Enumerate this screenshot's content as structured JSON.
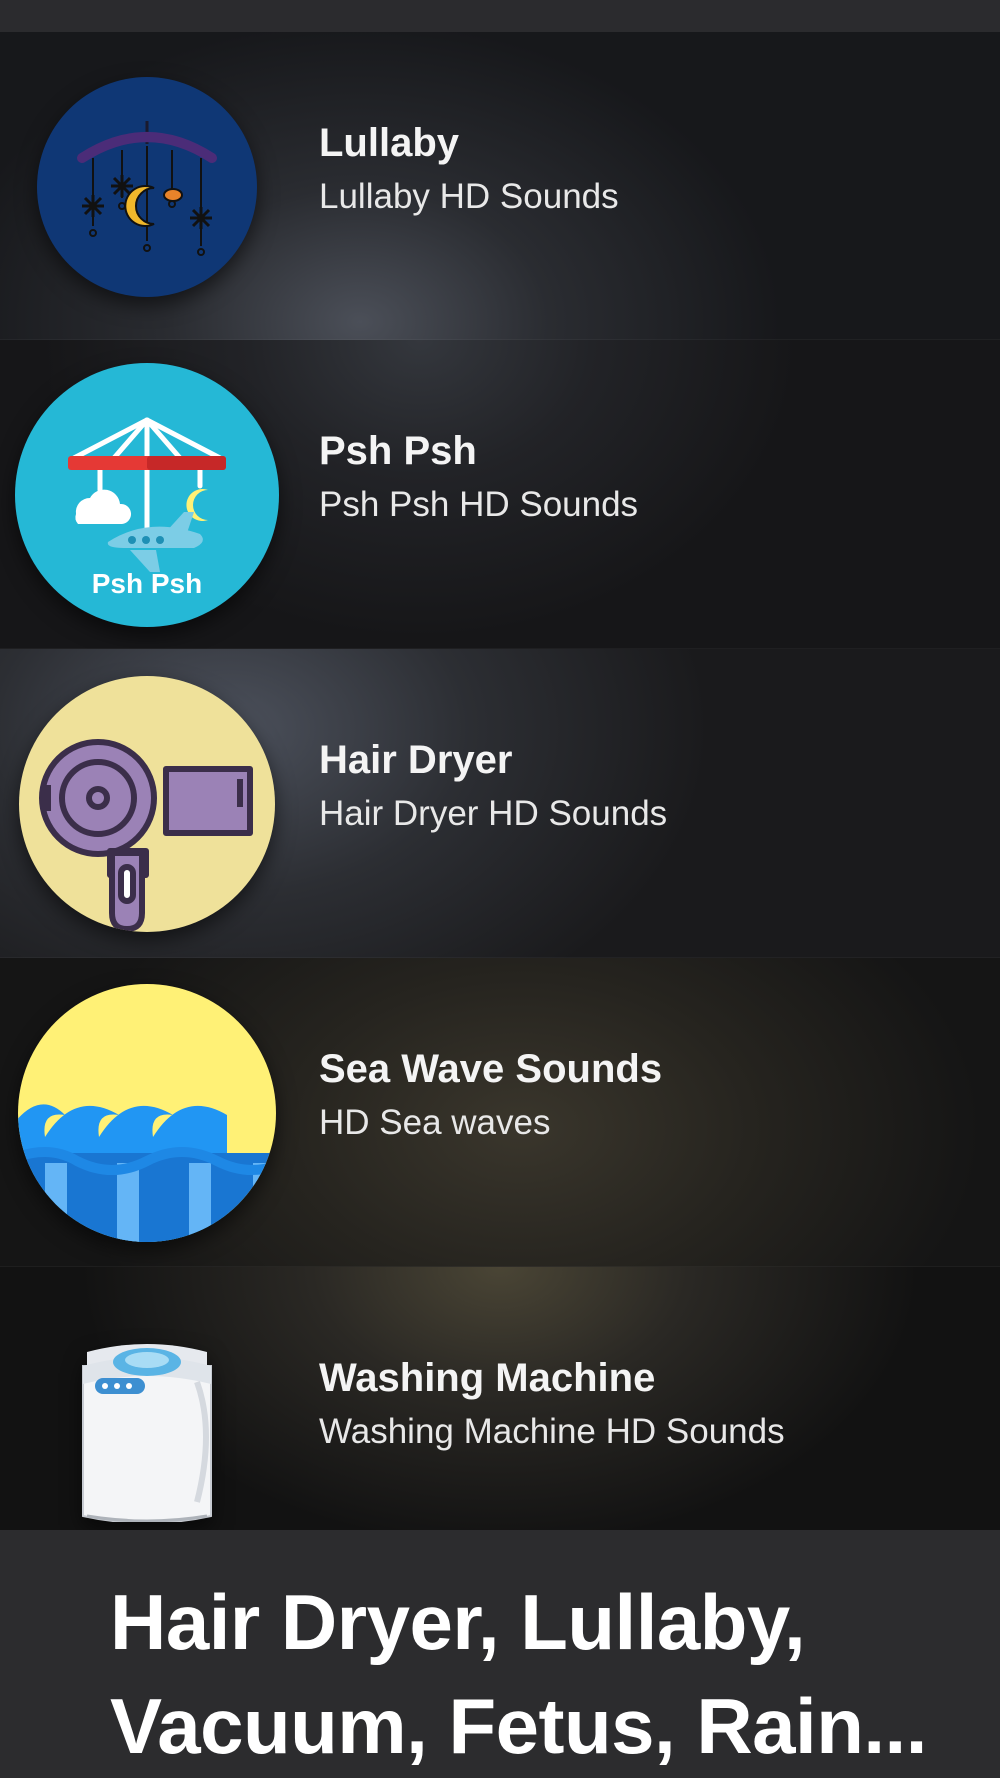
{
  "sounds": [
    {
      "title": "Lullaby",
      "subtitle": "Lullaby HD Sounds",
      "icon": "crib-mobile-icon"
    },
    {
      "title": "Psh Psh",
      "subtitle": "Psh Psh HD Sounds",
      "icon": "carousel-mobile-icon",
      "badge": "Psh Psh"
    },
    {
      "title": "Hair Dryer",
      "subtitle": "Hair Dryer HD Sounds",
      "icon": "hair-dryer-icon"
    },
    {
      "title": "Sea Wave Sounds",
      "subtitle": "HD Sea waves",
      "icon": "sea-wave-icon"
    },
    {
      "title": "Washing Machine",
      "subtitle": "Washing Machine HD Sounds",
      "icon": "washing-machine-icon"
    }
  ],
  "footer": {
    "text": "Hair Dryer, Lullaby, Vacuum, Fetus, Rain..."
  },
  "colors": {
    "lullaby_bg": "#0f3775",
    "pshpsh_bg": "#25b8d6",
    "hairdryer_bg": "#efe19a",
    "dryer_body": "#9b82b6",
    "wave_sky": "#fff176",
    "wave_water": "#2196f3"
  }
}
